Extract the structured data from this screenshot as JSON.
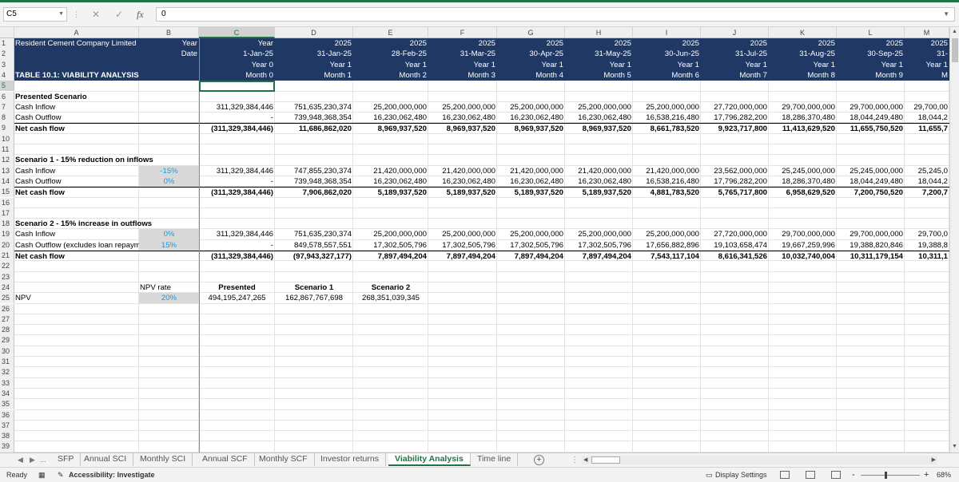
{
  "formula_bar": {
    "name_box": "C5",
    "formula": "0"
  },
  "columns": [
    "A",
    "B",
    "C",
    "D",
    "E",
    "F",
    "G",
    "H",
    "I",
    "J",
    "K",
    "L",
    "M"
  ],
  "rows": [
    "1",
    "2",
    "3",
    "4",
    "5",
    "6",
    "7",
    "8",
    "9",
    "10",
    "11",
    "12",
    "13",
    "14",
    "15",
    "16",
    "17",
    "18",
    "19",
    "20",
    "21",
    "22",
    "23",
    "24",
    "25",
    "26",
    "27",
    "28",
    "29",
    "30",
    "31",
    "32",
    "33",
    "34",
    "35",
    "36",
    "37",
    "38",
    "39"
  ],
  "header": {
    "company": "Resident Cement Company Limited",
    "year_label": "Year",
    "date_label": "Date",
    "title": "TABLE 10.1: VIABILITY ANALYSIS",
    "periods": [
      {
        "year": "Year",
        "date": "1-Jan-25",
        "yr": "Year 0",
        "month": "Month 0"
      },
      {
        "year": "2025",
        "date": "31-Jan-25",
        "yr": "Year 1",
        "month": "Month 1"
      },
      {
        "year": "2025",
        "date": "28-Feb-25",
        "yr": "Year 1",
        "month": "Month 2"
      },
      {
        "year": "2025",
        "date": "31-Mar-25",
        "yr": "Year 1",
        "month": "Month 3"
      },
      {
        "year": "2025",
        "date": "30-Apr-25",
        "yr": "Year 1",
        "month": "Month 4"
      },
      {
        "year": "2025",
        "date": "31-May-25",
        "yr": "Year 1",
        "month": "Month 5"
      },
      {
        "year": "2025",
        "date": "30-Jun-25",
        "yr": "Year 1",
        "month": "Month 6"
      },
      {
        "year": "2025",
        "date": "31-Jul-25",
        "yr": "Year 1",
        "month": "Month 7"
      },
      {
        "year": "2025",
        "date": "31-Aug-25",
        "yr": "Year 1",
        "month": "Month 8"
      },
      {
        "year": "2025",
        "date": "30-Sep-25",
        "yr": "Year 1",
        "month": "Month 9"
      },
      {
        "year": "2025",
        "date": "31-",
        "yr": "Year 1",
        "month": "M"
      }
    ]
  },
  "presented": {
    "heading": "Presented Scenario",
    "inflow_label": "Cash Inflow",
    "outflow_label": "Cash Outflow",
    "net_label": "Net cash flow",
    "inflow": [
      "311,329,384,446",
      "751,635,230,374",
      "25,200,000,000",
      "25,200,000,000",
      "25,200,000,000",
      "25,200,000,000",
      "25,200,000,000",
      "27,720,000,000",
      "29,700,000,000",
      "29,700,000,000",
      "29,700,00"
    ],
    "outflow": [
      "-",
      "739,948,368,354",
      "16,230,062,480",
      "16,230,062,480",
      "16,230,062,480",
      "16,230,062,480",
      "16,538,216,480",
      "17,796,282,200",
      "18,286,370,480",
      "18,044,249,480",
      "18,044,2"
    ],
    "net": [
      "(311,329,384,446)",
      "11,686,862,020",
      "8,969,937,520",
      "8,969,937,520",
      "8,969,937,520",
      "8,969,937,520",
      "8,661,783,520",
      "9,923,717,800",
      "11,413,629,520",
      "11,655,750,520",
      "11,655,7"
    ]
  },
  "scenario1": {
    "heading": "Scenario 1 - 15% reduction on inflows",
    "inflow_label": "Cash Inflow",
    "outflow_label": "Cash Outflow",
    "net_label": "Net cash flow",
    "inflow_adj": "-15%",
    "outflow_adj": "0%",
    "inflow": [
      "311,329,384,446",
      "747,855,230,374",
      "21,420,000,000",
      "21,420,000,000",
      "21,420,000,000",
      "21,420,000,000",
      "21,420,000,000",
      "23,562,000,000",
      "25,245,000,000",
      "25,245,000,000",
      "25,245,0"
    ],
    "outflow": [
      "-",
      "739,948,368,354",
      "16,230,062,480",
      "16,230,062,480",
      "16,230,062,480",
      "16,230,062,480",
      "16,538,216,480",
      "17,796,282,200",
      "18,286,370,480",
      "18,044,249,480",
      "18,044,2"
    ],
    "net": [
      "(311,329,384,446)",
      "7,906,862,020",
      "5,189,937,520",
      "5,189,937,520",
      "5,189,937,520",
      "5,189,937,520",
      "4,881,783,520",
      "5,765,717,800",
      "6,958,629,520",
      "7,200,750,520",
      "7,200,7"
    ]
  },
  "scenario2": {
    "heading": "Scenario 2 - 15% increase in outflows",
    "inflow_label": "Cash Inflow",
    "outflow_label": "Cash Outflow (excludes loan repaym",
    "net_label": "Net cash flow",
    "inflow_adj": "0%",
    "outflow_adj": "15%",
    "inflow": [
      "311,329,384,446",
      "751,635,230,374",
      "25,200,000,000",
      "25,200,000,000",
      "25,200,000,000",
      "25,200,000,000",
      "25,200,000,000",
      "27,720,000,000",
      "29,700,000,000",
      "29,700,000,000",
      "29,700,0"
    ],
    "outflow": [
      "-",
      "849,578,557,551",
      "17,302,505,796",
      "17,302,505,796",
      "17,302,505,796",
      "17,302,505,796",
      "17,656,882,896",
      "19,103,658,474",
      "19,667,259,996",
      "19,388,820,846",
      "19,388,8"
    ],
    "net": [
      "(311,329,384,446)",
      "(97,943,327,177)",
      "7,897,494,204",
      "7,897,494,204",
      "7,897,494,204",
      "7,897,494,204",
      "7,543,117,104",
      "8,616,341,526",
      "10,032,740,004",
      "10,311,179,154",
      "10,311,1"
    ]
  },
  "npv": {
    "rate_label": "NPV rate",
    "label": "NPV",
    "rate": "20%",
    "headers": [
      "Presented",
      "Scenario 1",
      "Scenario 2"
    ],
    "values": [
      "494,195,247,265",
      "162,867,767,698",
      "268,351,039,345"
    ]
  },
  "sheet_tabs": {
    "more": "...",
    "tabs": [
      "SFP",
      "Annual SCI",
      "Monthly SCI",
      "Annual SCF",
      "Monthly SCF",
      "Investor returns",
      "Viability Analysis",
      "Time line"
    ],
    "active": "Viability Analysis",
    "add": "+"
  },
  "status": {
    "ready": "Ready",
    "accessibility": "Accessibility: Investigate",
    "display_settings": "Display Settings",
    "zoom": "68%",
    "zoom_minus": "-",
    "zoom_plus": "+"
  },
  "colors": {
    "excel_green": "#217346",
    "header_band": "#1f3864",
    "input_blue": "#1e9ad6",
    "input_fill": "#d9d9d9"
  }
}
